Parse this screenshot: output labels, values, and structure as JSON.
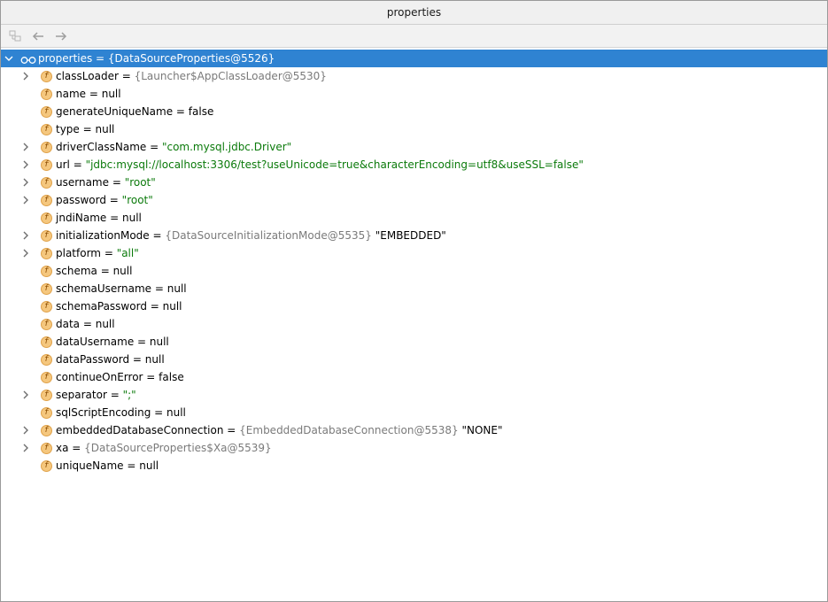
{
  "window": {
    "title": "properties"
  },
  "toolbar": {
    "items": [
      {
        "name": "layout-icon"
      },
      {
        "name": "back-arrow-icon"
      },
      {
        "name": "forward-arrow-icon"
      }
    ]
  },
  "root": {
    "label": "properties = ",
    "value": "{DataSourceProperties@5526}"
  },
  "fields": [
    {
      "name": "classLoader",
      "eq": " = ",
      "obj": "{Launcher$AppClassLoader@5530}",
      "val": "",
      "valType": "",
      "expandable": true
    },
    {
      "name": "name",
      "eq": " = ",
      "obj": "",
      "val": "null",
      "valType": "plain",
      "expandable": false
    },
    {
      "name": "generateUniqueName",
      "eq": " = ",
      "obj": "",
      "val": "false",
      "valType": "plain",
      "expandable": false
    },
    {
      "name": "type",
      "eq": " = ",
      "obj": "",
      "val": "null",
      "valType": "plain",
      "expandable": false
    },
    {
      "name": "driverClassName",
      "eq": " = ",
      "obj": "",
      "val": "\"com.mysql.jdbc.Driver\"",
      "valType": "str",
      "expandable": true
    },
    {
      "name": "url",
      "eq": " = ",
      "obj": "",
      "val": "\"jdbc:mysql://localhost:3306/test?useUnicode=true&characterEncoding=utf8&useSSL=false\"",
      "valType": "str",
      "expandable": true
    },
    {
      "name": "username",
      "eq": " = ",
      "obj": "",
      "val": "\"root\"",
      "valType": "str",
      "expandable": true
    },
    {
      "name": "password",
      "eq": " = ",
      "obj": "",
      "val": "\"root\"",
      "valType": "str",
      "expandable": true
    },
    {
      "name": "jndiName",
      "eq": " = ",
      "obj": "",
      "val": "null",
      "valType": "plain",
      "expandable": false
    },
    {
      "name": "initializationMode",
      "eq": " = ",
      "obj": "{DataSourceInitializationMode@5535}",
      "val": " \"EMBEDDED\"",
      "valType": "plain",
      "expandable": true
    },
    {
      "name": "platform",
      "eq": " = ",
      "obj": "",
      "val": "\"all\"",
      "valType": "str",
      "expandable": true
    },
    {
      "name": "schema",
      "eq": " = ",
      "obj": "",
      "val": "null",
      "valType": "plain",
      "expandable": false
    },
    {
      "name": "schemaUsername",
      "eq": " = ",
      "obj": "",
      "val": "null",
      "valType": "plain",
      "expandable": false
    },
    {
      "name": "schemaPassword",
      "eq": " = ",
      "obj": "",
      "val": "null",
      "valType": "plain",
      "expandable": false
    },
    {
      "name": "data",
      "eq": " = ",
      "obj": "",
      "val": "null",
      "valType": "plain",
      "expandable": false
    },
    {
      "name": "dataUsername",
      "eq": " = ",
      "obj": "",
      "val": "null",
      "valType": "plain",
      "expandable": false
    },
    {
      "name": "dataPassword",
      "eq": " = ",
      "obj": "",
      "val": "null",
      "valType": "plain",
      "expandable": false
    },
    {
      "name": "continueOnError",
      "eq": " = ",
      "obj": "",
      "val": "false",
      "valType": "plain",
      "expandable": false
    },
    {
      "name": "separator",
      "eq": " = ",
      "obj": "",
      "val": "\";\"",
      "valType": "str",
      "expandable": true
    },
    {
      "name": "sqlScriptEncoding",
      "eq": " = ",
      "obj": "",
      "val": "null",
      "valType": "plain",
      "expandable": false
    },
    {
      "name": "embeddedDatabaseConnection",
      "eq": " = ",
      "obj": "{EmbeddedDatabaseConnection@5538}",
      "val": " \"NONE\"",
      "valType": "plain",
      "expandable": true
    },
    {
      "name": "xa",
      "eq": " = ",
      "obj": "{DataSourceProperties$Xa@5539}",
      "val": "",
      "valType": "",
      "expandable": true
    },
    {
      "name": "uniqueName",
      "eq": " = ",
      "obj": "",
      "val": "null",
      "valType": "plain",
      "expandable": false
    }
  ],
  "badge_letter": "f",
  "colors": {
    "selection": "#2f83d2",
    "string_value": "#0b7a0b",
    "object_ref": "#7a7a7a",
    "field_badge": "#f5c77e"
  }
}
